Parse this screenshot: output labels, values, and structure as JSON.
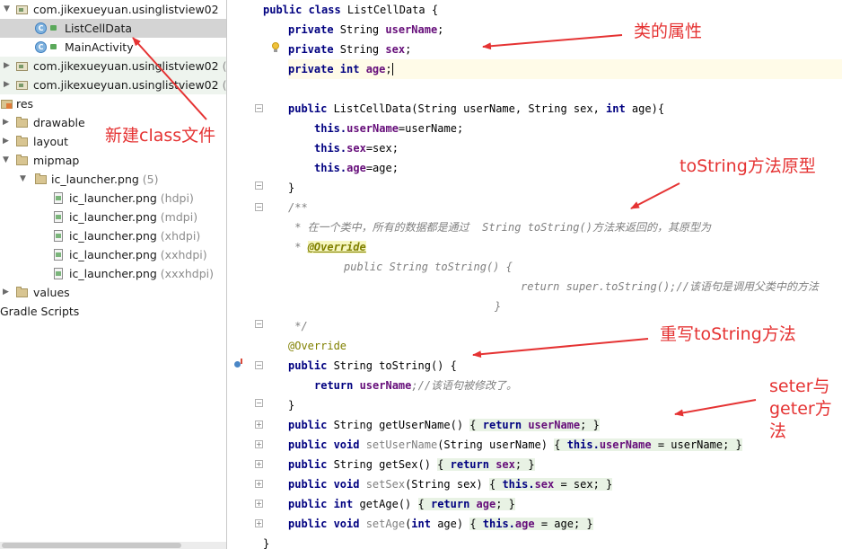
{
  "tree": {
    "rows": [
      {
        "label": "com.jikexueyuan.usinglistview02",
        "suffix": ""
      },
      {
        "label": "ListCellData",
        "suffix": ""
      },
      {
        "label": "MainActivity",
        "suffix": ""
      },
      {
        "label": "com.jikexueyuan.usinglistview02",
        "suffix": " (and"
      },
      {
        "label": "com.jikexueyuan.usinglistview02",
        "suffix": " (test)"
      },
      {
        "label": "res",
        "suffix": ""
      },
      {
        "label": "drawable",
        "suffix": ""
      },
      {
        "label": "layout",
        "suffix": ""
      },
      {
        "label": "mipmap",
        "suffix": ""
      },
      {
        "label": "ic_launcher.png",
        "suffix": " (5)"
      },
      {
        "label": "ic_launcher.png",
        "suffix": " (hdpi)"
      },
      {
        "label": "ic_launcher.png",
        "suffix": " (mdpi)"
      },
      {
        "label": "ic_launcher.png",
        "suffix": " (xhdpi)"
      },
      {
        "label": "ic_launcher.png",
        "suffix": " (xxhdpi)"
      },
      {
        "label": "ic_launcher.png",
        "suffix": " (xxxhdpi)"
      },
      {
        "label": "values",
        "suffix": ""
      },
      {
        "label": "Gradle Scripts",
        "suffix": ""
      }
    ],
    "class_icon_letter": "C",
    "icons": [
      "package-icon",
      "class-icon",
      "lock-icon",
      "res-folder-icon",
      "folder-icon",
      "image-file-icon"
    ]
  },
  "code": {
    "l1": {
      "a": "public class ",
      "b": "ListCellData {"
    },
    "l2": {
      "a": "private ",
      "b": "String ",
      "c": "userName",
      "d": ";"
    },
    "l3": {
      "a": "private ",
      "b": "String ",
      "c": "sex",
      "d": ";"
    },
    "l4": {
      "a": "private int ",
      "c": "age",
      "d": ";"
    },
    "l6": {
      "a": "public ",
      "b": "ListCellData(String userName, String sex, ",
      "c": "int ",
      "d": "age){"
    },
    "l7": {
      "a": "this.",
      "b": "userName",
      "c": "=userName;"
    },
    "l8": {
      "a": "this.",
      "b": "sex",
      "c": "=sex;"
    },
    "l9": {
      "a": "this.",
      "b": "age",
      "c": "=age;"
    },
    "l10": {
      "a": "}"
    },
    "l11": {
      "a": "/**"
    },
    "l12": {
      "a": " * 在一个类中，所有的数据都是通过  String toString()方法来返回的，其原型为"
    },
    "l13": {
      "a": " * ",
      "b": "@Override"
    },
    "l14": {
      "a": "public String toString() {"
    },
    "l15": {
      "a": "return super.toString();//该语句是调用父类中的方法"
    },
    "l16": {
      "a": "}"
    },
    "l17": {
      "a": " */"
    },
    "l18": {
      "a": "@Override"
    },
    "l19": {
      "a": "public ",
      "b": "String toString() {"
    },
    "l20": {
      "a": "return ",
      "b": "userName",
      "c": ";//该语句被修改了。"
    },
    "l21": {
      "a": "}"
    },
    "l22": {
      "a": "public ",
      "b": "String getUserName() ",
      "c": "{ ",
      "d": "return ",
      "e": "userName",
      "f": "; }"
    },
    "l23": {
      "a": "public void ",
      "b": "setUserName",
      "c": "(String userName) ",
      "d": "{ ",
      "e": "this.",
      "f": "userName",
      "g": " = userName; }"
    },
    "l24": {
      "a": "public ",
      "b": "String getSex() ",
      "c": "{ ",
      "d": "return ",
      "e": "sex",
      "f": "; }"
    },
    "l25": {
      "a": "public void ",
      "b": "setSex",
      "c": "(String sex) ",
      "d": "{ ",
      "e": "this.",
      "f": "sex",
      "g": " = sex; }"
    },
    "l26": {
      "a": "public int ",
      "b": "getAge() ",
      "c": "{ ",
      "d": "return ",
      "e": "age",
      "f": "; }"
    },
    "l27": {
      "a": "public void ",
      "b": "setAge",
      "c": "(",
      "c2": "int ",
      "c3": "age) ",
      "d": "{ ",
      "e": "this.",
      "f": "age",
      "g": " = age; }"
    },
    "l28": {
      "a": "}"
    }
  },
  "notes": {
    "class_file": "新建class文件",
    "attributes": "类的属性",
    "tostring_proto": "toString方法原型",
    "override_tostring": "重写toString方法",
    "seter_line1": "seter与",
    "seter_line2": "geter方",
    "seter_line3": "法"
  },
  "colors": {
    "keyword": "#000080",
    "field": "#660e7a",
    "comment": "#808080",
    "annotation": "#808000",
    "note": "#e53333",
    "selection": "#d4d4d4"
  }
}
